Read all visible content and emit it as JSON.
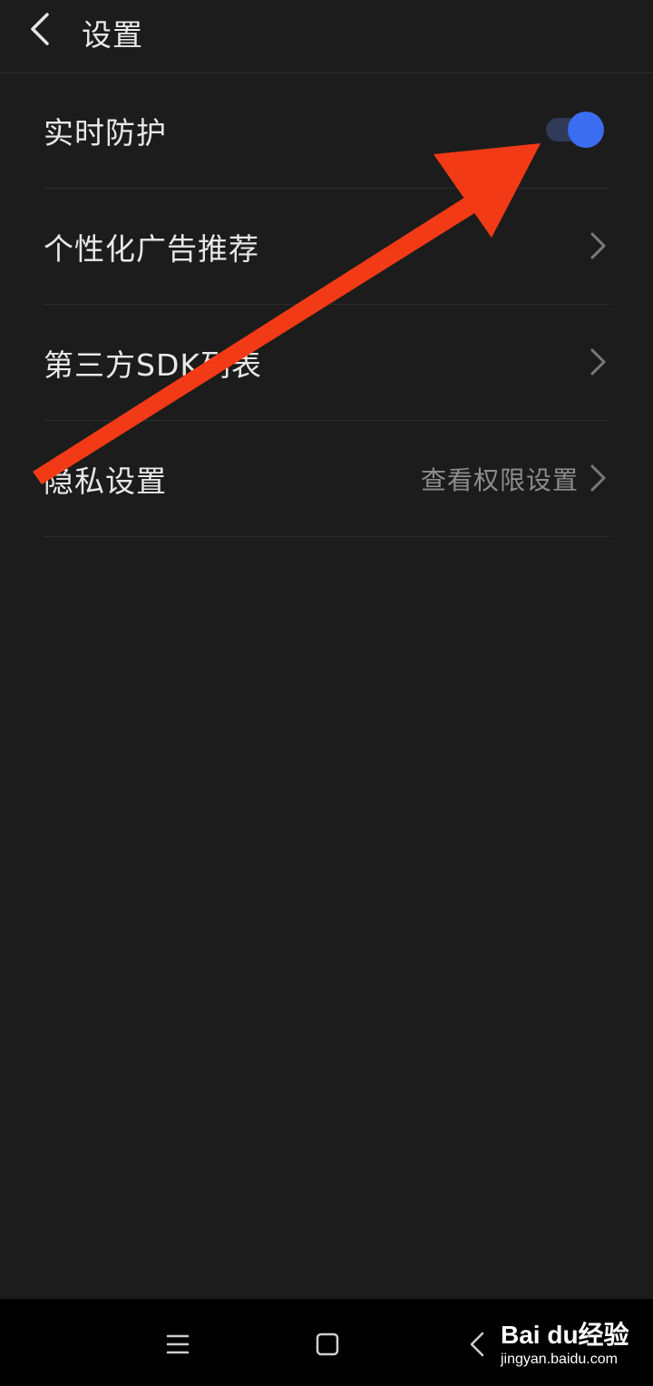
{
  "header": {
    "title": "设置"
  },
  "settings": [
    {
      "label": "实时防护",
      "type": "toggle",
      "enabled": true
    },
    {
      "label": "个性化广告推荐",
      "type": "link"
    },
    {
      "label": "第三方SDK列表",
      "type": "link"
    },
    {
      "label": "隐私设置",
      "type": "link",
      "value": "查看权限设置"
    }
  ],
  "colors": {
    "background": "#1c1c1c",
    "toggle_on": "#3a6df0",
    "annotation_arrow": "#f33a16"
  },
  "watermark": {
    "brand": "Bai du经验",
    "url": "jingyan.baidu.com"
  },
  "navbar": {
    "icons": [
      "menu-icon",
      "home-square-icon",
      "back-chevron-icon"
    ]
  }
}
